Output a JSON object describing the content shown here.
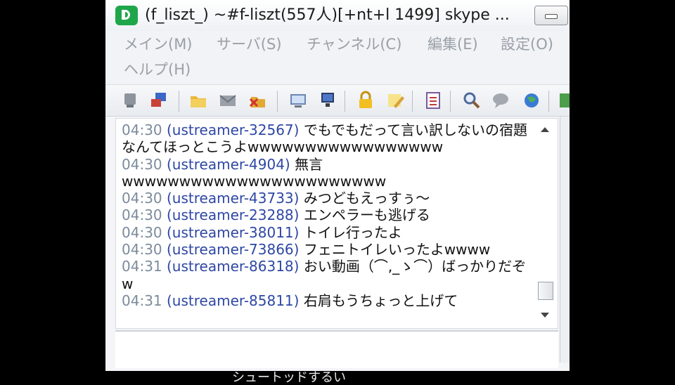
{
  "window": {
    "title": "(f_liszt_) ~#f-liszt(557人)[+nt+l 1499] skype ..."
  },
  "menu": {
    "items": [
      {
        "label": "メイン(M)"
      },
      {
        "label": "サーバ(S)"
      },
      {
        "label": "チャンネル(C)"
      },
      {
        "label": "編集(E)"
      },
      {
        "label": "設定(O)"
      },
      {
        "label": "ヘルプ(H)"
      }
    ]
  },
  "toolbar": {
    "icons": [
      "server-list-icon",
      "connect-icon",
      "folder-icon",
      "mail-icon",
      "disconnect-icon",
      "monitor-icon",
      "computer-icon",
      "lock-icon",
      "notes-icon",
      "checklist-icon",
      "search-icon",
      "chat-bubble-icon",
      "globe-icon",
      "door-exit-icon"
    ]
  },
  "chat": {
    "messages": [
      {
        "time": "04:30",
        "nick": "(ustreamer-32567)",
        "text": "でもでもだって言い訳しないの宿題なんてほっとこうよwwwwwwwwwwwwwwwww"
      },
      {
        "time": "04:30",
        "nick": "(ustreamer-4904)",
        "text": "無言wwwwwwwwwwwwwwwwwwwwwww"
      },
      {
        "time": "04:30",
        "nick": "(ustreamer-43733)",
        "text": "みつどもえっすぅ～"
      },
      {
        "time": "04:30",
        "nick": "(ustreamer-23288)",
        "text": "エンペラーも逃げる"
      },
      {
        "time": "04:30",
        "nick": "(ustreamer-38011)",
        "text": "トイレ行ったよ"
      },
      {
        "time": "04:30",
        "nick": "(ustreamer-73866)",
        "text": "フェニトイレいったよwwww"
      },
      {
        "time": "04:31",
        "nick": "(ustreamer-86318)",
        "text": "おい動画（⌒,_ゝ⌒）ばっかりだぞw"
      },
      {
        "time": "04:31",
        "nick": "(ustreamer-85811)",
        "text": "右肩もうちょっと上げて"
      }
    ]
  },
  "overlay": {
    "bottom_text": "シュートッドするい"
  },
  "colors": {
    "time": "#7c8b9c",
    "nick": "#2e47a4",
    "menu_text": "#9aa0a8",
    "app_icon": "#1fa64b"
  }
}
